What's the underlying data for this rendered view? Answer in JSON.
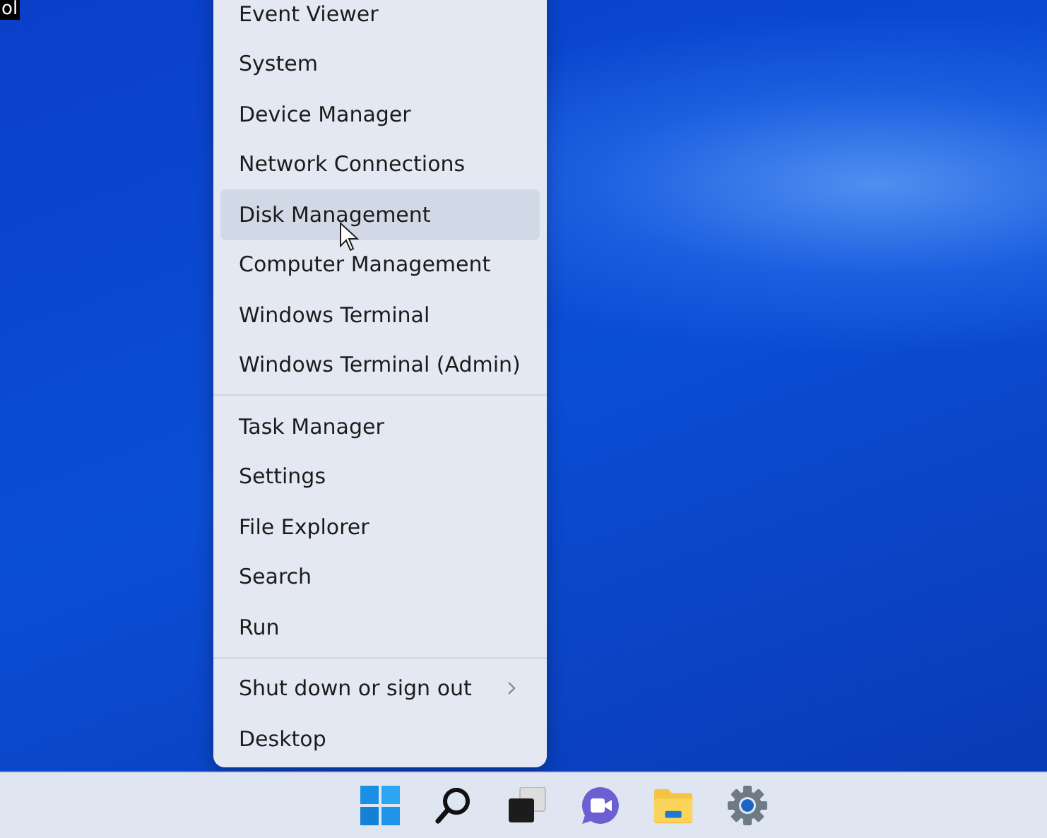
{
  "desktop": {
    "corner_text": "ol"
  },
  "context_menu": {
    "groups": [
      {
        "items": [
          {
            "label": "Event Viewer",
            "kind": "item",
            "hovered": false
          },
          {
            "label": "System",
            "kind": "item",
            "hovered": false
          },
          {
            "label": "Device Manager",
            "kind": "item",
            "hovered": false
          },
          {
            "label": "Network Connections",
            "kind": "item",
            "hovered": false
          },
          {
            "label": "Disk Management",
            "kind": "item",
            "hovered": true
          },
          {
            "label": "Computer Management",
            "kind": "item",
            "hovered": false
          },
          {
            "label": "Windows Terminal",
            "kind": "item",
            "hovered": false
          },
          {
            "label": "Windows Terminal (Admin)",
            "kind": "item",
            "hovered": false
          }
        ]
      },
      {
        "items": [
          {
            "label": "Task Manager",
            "kind": "item",
            "hovered": false
          },
          {
            "label": "Settings",
            "kind": "item",
            "hovered": false
          },
          {
            "label": "File Explorer",
            "kind": "item",
            "hovered": false
          },
          {
            "label": "Search",
            "kind": "item",
            "hovered": false
          },
          {
            "label": "Run",
            "kind": "item",
            "hovered": false
          }
        ]
      },
      {
        "items": [
          {
            "label": "Shut down or sign out",
            "kind": "submenu",
            "hovered": false
          },
          {
            "label": "Desktop",
            "kind": "item",
            "hovered": false
          }
        ]
      }
    ]
  },
  "taskbar": {
    "icons": [
      {
        "kind": "start"
      },
      {
        "kind": "search"
      },
      {
        "kind": "taskview"
      },
      {
        "kind": "chat"
      },
      {
        "kind": "folder"
      },
      {
        "kind": "gear"
      }
    ]
  }
}
